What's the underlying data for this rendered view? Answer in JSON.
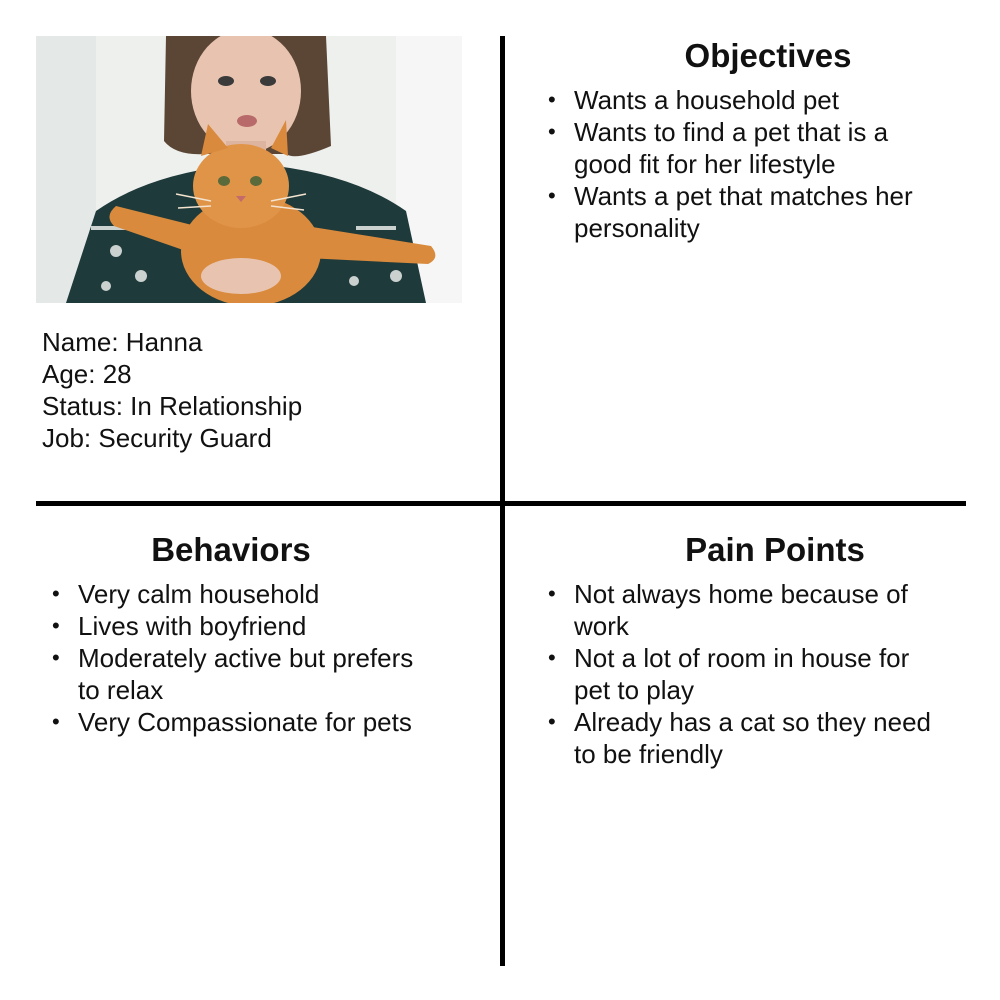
{
  "persona": {
    "name_line": "Name: Hanna",
    "age_line": "Age: 28",
    "status_line": "Status: In Relationship",
    "job_line": "Job: Security Guard"
  },
  "objectives": {
    "title": "Objectives",
    "items": [
      [
        "Wants a household pet"
      ],
      [
        "Wants to find a pet that is a",
        "good fit for her lifestyle"
      ],
      [
        "Wants a pet that matches her",
        "personality"
      ]
    ]
  },
  "behaviors": {
    "title": "Behaviors",
    "items": [
      [
        "Very calm household"
      ],
      [
        "Lives with boyfriend"
      ],
      [
        "Moderately active but prefers",
        "to relax"
      ],
      [
        "Very Compassionate for pets"
      ]
    ]
  },
  "pain_points": {
    "title": "Pain Points",
    "items": [
      [
        "Not always home because of",
        "work"
      ],
      [
        "Not a lot of room in house for",
        "pet to play"
      ],
      [
        "Already has a cat so they need",
        "to be friendly"
      ]
    ]
  },
  "bullet_glyph": "•",
  "colors": {
    "divider": "#000000",
    "text": "#111111",
    "cat": "#d98a3d",
    "sweater": "#1f3a3a"
  }
}
